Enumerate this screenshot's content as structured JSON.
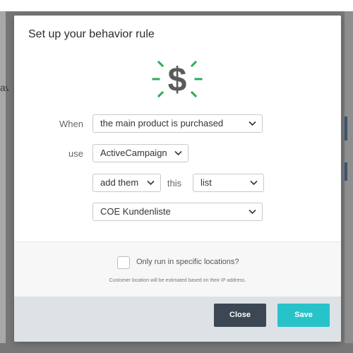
{
  "modal": {
    "title": "Set up your behavior rule"
  },
  "icon": {
    "name": "dollar-sign-icon",
    "color": "#5a5a5a",
    "ray_color": "#2eab5b"
  },
  "rule": {
    "when_label": "When",
    "when_value": "the main product is purchased",
    "use_label": "use",
    "use_value": "ActiveCampaign",
    "action_value": "add them",
    "this_label": "this",
    "target_type_value": "list",
    "list_value": "COE Kundenliste"
  },
  "location": {
    "checkbox_label": "Only run in specific locations?",
    "checked": false,
    "hint": "Customer location will be estimated based on their IP address."
  },
  "footer": {
    "close_label": "Close",
    "save_label": "Save",
    "close_color": "#3b4752",
    "save_color": "#27c3c9"
  },
  "background": {
    "peek_text": "av"
  }
}
